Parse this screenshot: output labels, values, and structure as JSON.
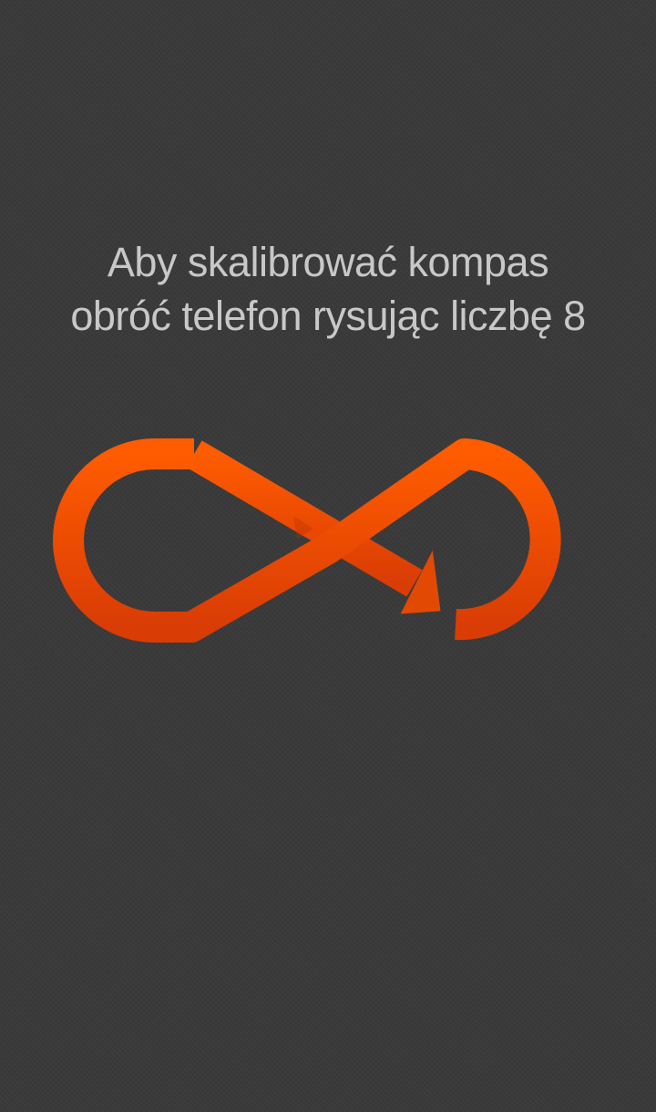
{
  "calibration": {
    "line1": "Aby skalibrować kompas",
    "line2": "obróć telefon rysując liczbę 8",
    "icon": "figure-eight-arrow-icon",
    "colors": {
      "background": "#3a3a3a",
      "text": "#c8c8c8",
      "accent_top": "#ff5a00",
      "accent_bottom": "#d83a06"
    }
  }
}
